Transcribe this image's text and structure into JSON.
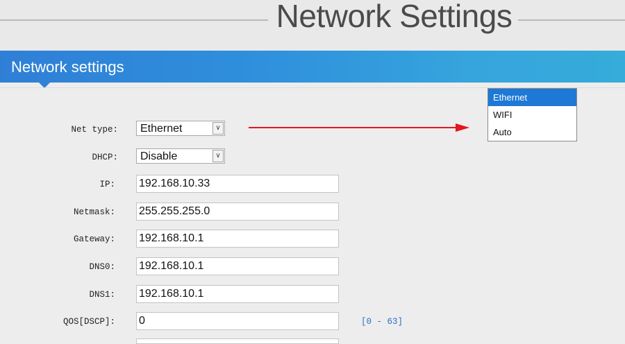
{
  "header": {
    "title": "Network Settings"
  },
  "section": {
    "title": "Network settings"
  },
  "form": {
    "net_type": {
      "label": "Net type:",
      "value": "Ethernet"
    },
    "dhcp": {
      "label": "DHCP:",
      "value": "Disable"
    },
    "ip": {
      "label": "IP:",
      "value": "192.168.10.33"
    },
    "netmask": {
      "label": "Netmask:",
      "value": "255.255.255.0"
    },
    "gateway": {
      "label": "Gateway:",
      "value": "192.168.10.1"
    },
    "dns0": {
      "label": "DNS0:",
      "value": "192.168.10.1"
    },
    "dns1": {
      "label": "DNS1:",
      "value": "192.168.10.1"
    },
    "qos": {
      "label": "QOS[DSCP]:",
      "value": "0",
      "hint": "[0 - 63]"
    }
  },
  "net_type_dropdown": {
    "options": [
      "Ethernet",
      "WIFI",
      "Auto"
    ],
    "selected": "Ethernet"
  },
  "icons": {
    "select_arrow": "chevron-down-icon",
    "annotation": "red-arrow-icon"
  },
  "colors": {
    "section_bar": "#2f8fdc",
    "dropdown_selected": "#1d78d6",
    "arrow": "#e4161c",
    "hint": "#2a6fc4"
  }
}
